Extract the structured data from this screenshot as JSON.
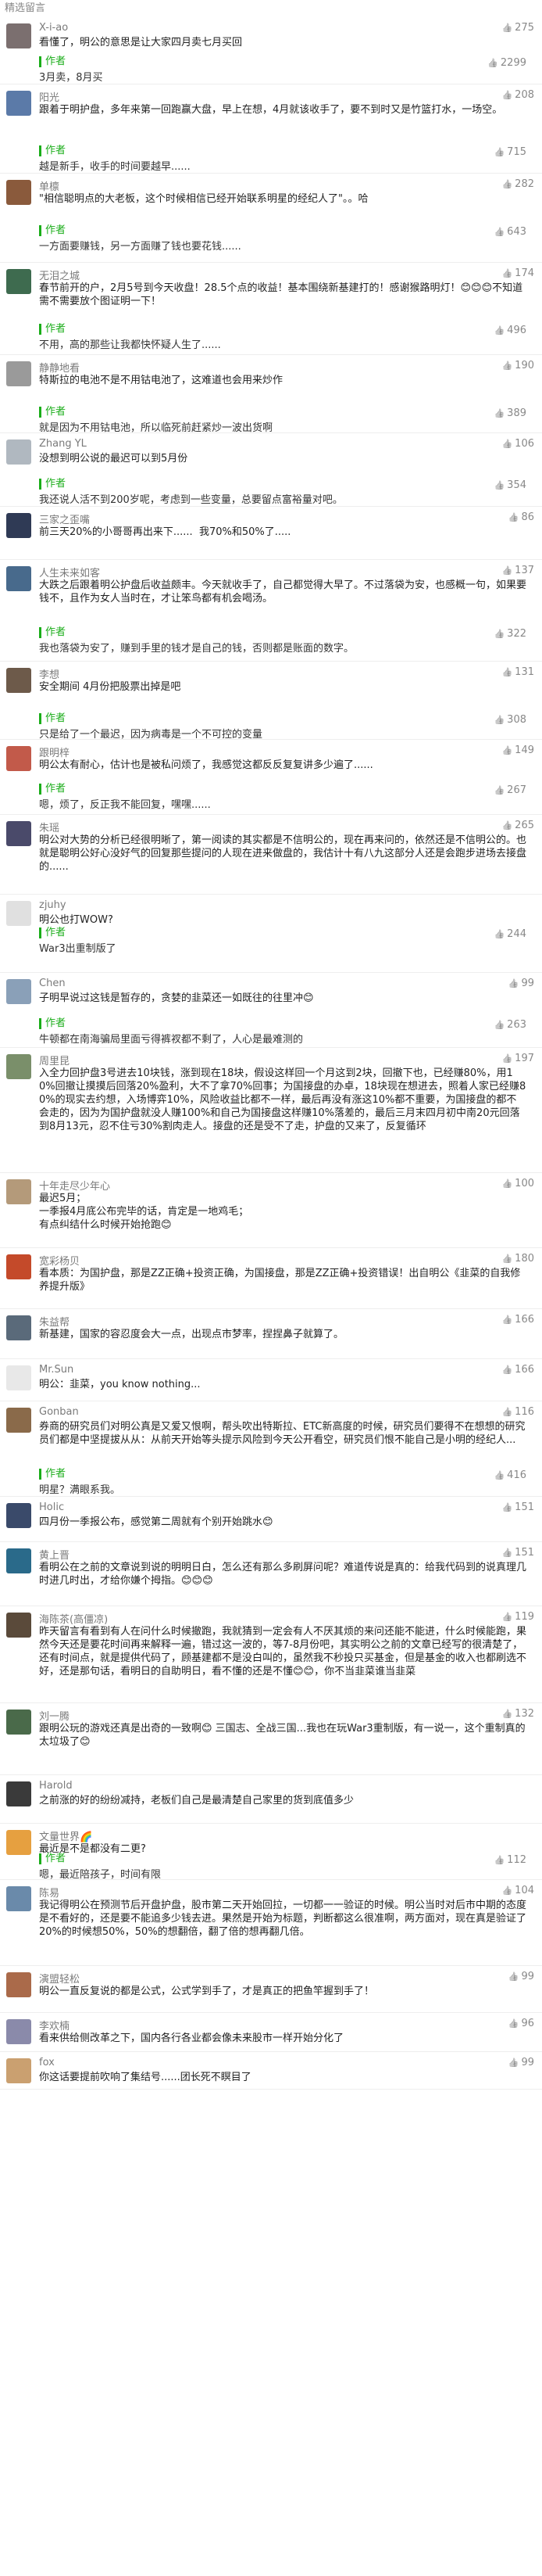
{
  "section_title": "精选留言",
  "author_label": "作者",
  "comments": [
    {
      "user": "X-i-ao",
      "likes": "275",
      "text": "看懂了，明公的意思是让大家四月卖七月买回",
      "reply_likes": "2299",
      "reply": "3月卖，8月买",
      "avatar_color": "#7b6f6f"
    },
    {
      "user": "阳光",
      "likes": "208",
      "text": "跟着于明护盘，多年来第一回跑赢大盘，早上在想，4月就该收手了，要不到时又是竹篮打水，一场空。",
      "reply_likes": "715",
      "reply": "越是新手，收手的时间要越早......",
      "avatar_color": "#5b7aa8"
    },
    {
      "user": "单檩",
      "likes": "282",
      "text": "\"相信聪明点的大老板，这个时候相信已经开始联系明星的经纪人了\"。。哈",
      "reply_likes": "643",
      "reply": "一方面要赚钱，另一方面赚了钱也要花钱......",
      "avatar_color": "#8a5a3c"
    },
    {
      "user": "无泪之城",
      "likes": "174",
      "text": "春节前开的户，2月5号到今天收盘！28.5个点的收益！基本围绕新基建打的！感谢猴路明灯！😊😊😊不知道需不需要放个图证明一下！",
      "reply_likes": "496",
      "reply": "不用，高的那些让我都快怀疑人生了......",
      "avatar_color": "#3e6b4f"
    },
    {
      "user": "静静地看",
      "likes": "190",
      "text": "特斯拉的电池不是不用钴电池了，这难道也会用来炒作",
      "reply_likes": "389",
      "reply": "就是因为不用钴电池，所以临死前赶紧炒一波出货啊",
      "avatar_color": "#9a9a9a"
    },
    {
      "user": "Zhang YL",
      "likes": "106",
      "text": "没想到明公说的最迟可以到5月份",
      "reply_likes": "354",
      "reply": "我还说人活不到200岁呢，考虑到一些变量，总要留点富裕量对吧。",
      "avatar_color": "#b0b8c0"
    },
    {
      "user": "三家之歪嘴",
      "likes": "86",
      "text": "前三天20%的小哥哥再出来下......  我70%和50%了.....",
      "reply_likes": "",
      "reply": "",
      "avatar_color": "#2f3a55"
    },
    {
      "user": "人生未来如客",
      "likes": "137",
      "text": "大跌之后跟着明公护盘后收益颇丰。今天就收手了，自己都觉得大早了。不过落袋为安，也感概一句，如果要钱不，且作为女人当时在，才让笨鸟都有机会喝汤。",
      "reply_likes": "322",
      "reply": "我也落袋为安了，赚到手里的钱才是自己的钱，否则都是账面的数字。",
      "avatar_color": "#486a8c"
    },
    {
      "user": "李想",
      "likes": "131",
      "text": "安全期间 4月份把股票出掉是吧",
      "reply_likes": "308",
      "reply": "只是给了一个最迟，因为病毒是一个不可控的变量",
      "avatar_color": "#6d5a4a"
    },
    {
      "user": "跟明梓",
      "likes": "149",
      "text": "明公太有耐心，估计也是被私问烦了，我感觉这都反反复复讲多少遍了......",
      "reply_likes": "267",
      "reply": "嗯，烦了，反正我不能回复，嘿嘿......",
      "avatar_color": "#c25a4a"
    },
    {
      "user": "朱瑶",
      "likes": "265",
      "text": "明公对大势的分析已经很明晰了，第一阅读的其实都是不信明公的，现在再来问的，依然还是不信明公的。也就是聪明公好心没好气的回复那些提问的人现在进来做盘的，我估计十有八九这部分人还是会跑步进场去接盘的......",
      "reply_likes": "",
      "reply": "",
      "avatar_color": "#4a4a6a"
    },
    {
      "user": "zjuhy",
      "likes": "",
      "text": "明公也打WOW?",
      "reply_likes": "244",
      "reply": "War3出重制版了",
      "avatar_color": "#e0e0e0"
    },
    {
      "user": "Chen",
      "likes": "99",
      "text": "子明早说过这钱是暂存的，贪婪的韭菜还一如既往的往里冲😊",
      "reply_likes": "263",
      "reply": "牛顿都在南海骗局里面亏得裤衩都不剩了，人心是最难测的",
      "avatar_color": "#8aa0b8"
    },
    {
      "user": "周里昆",
      "likes": "197",
      "text": "入全力回护盘3号进去10块钱，涨到现在18块，假设这样回一个月这到2块，回撤下也，已经赚80%，用10%回撤让摸摸后回落20%盈利，大不了拿70%回事；为国接盘的办卓，18块现在想进去，照着人家已经赚80%的现实去约想，入场博弈10%，风险收益比都不一样，最后再没有涨这10%都不重要，为国接盘的都不会走的，因为为国护盘就没人赚100%和自己为国接盘这样赚10%落差的，最后三月末四月初中南20元回落到8月13元，忍不住亏30%割肉走人。接盘的还是受不了走，护盘的又来了，反复循环",
      "reply_likes": "",
      "reply": "",
      "avatar_color": "#7a8f6a"
    },
    {
      "user": "十年走尽少年心",
      "likes": "100",
      "text": "最迟5月；\n一季报4月底公布完毕的话，肯定是一地鸡毛；\n有点纠结什么时候开始抢跑😊",
      "reply_likes": "",
      "reply": "",
      "avatar_color": "#b49a7a"
    },
    {
      "user": "宽彩杨贝",
      "likes": "180",
      "text": "看本质：为国护盘，那是ZZ正确+投资正确，为国接盘，那是ZZ正确+投资错误！出自明公《韭菜的自我修养提升版》",
      "reply_likes": "",
      "reply": "",
      "avatar_color": "#c44a2a"
    },
    {
      "user": "朱益帮",
      "likes": "166",
      "text": "新基建，国家的容忍度会大一点，出现点市梦率，捏捏鼻子就算了。",
      "reply_likes": "",
      "reply": "",
      "avatar_color": "#5a6a7a"
    },
    {
      "user": "Mr.Sun",
      "likes": "166",
      "text": "明公：韭菜，you know nothing...",
      "reply_likes": "",
      "reply": "",
      "avatar_color": "#e8e8e8"
    },
    {
      "user": "Gonban",
      "likes": "116",
      "text": "券商的研究员们对明公真是又爱又恨啊，帮头吹出特斯拉、ETC新高度的时候，研究员们要得不在想想的研究员们都是中坚提拔从从：从前天开始等头提示风险到今天公开看空，研究员们恨不能自己是小明的经纪人...",
      "reply_likes": "416",
      "reply": "明星？满眼系我。",
      "avatar_color": "#8a6a4a"
    },
    {
      "user": "Holic",
      "likes": "151",
      "text": "四月份一季报公布，感觉第二周就有个别开始跳水😊",
      "reply_likes": "",
      "reply": "",
      "avatar_color": "#3a4a6a"
    },
    {
      "user": "黄上晋",
      "likes": "151",
      "text": "看明公在之前的文章说到说的明明日白，怎么还有那么多刷屏问呢？难道传说是真的：给我代码到的说真理几时进几时出，才给你嫌个拇指。😊😊😊",
      "reply_likes": "",
      "reply": "",
      "avatar_color": "#2a6a8a"
    },
    {
      "user": "海陈茶(高僵凉)",
      "likes": "119",
      "text": "昨天留言有看到有人在问什么时候撤跑，我就猜到一定会有人不厌其烦的来问还能不能进，什么时候能跑，果然今天还是要花时间再来解释一遍，错过这一波的，等7-8月份吧，其实明公之前的文章已经写的很清楚了，还有时间点，就是提供代码了，顾基建都不是没白叫的，虽然我不秒投只买基金，但是基金的收入也都刷选不好，还是那句话，看明日的自助明日，看不懂的还是不懂😊😊，你不当韭菜谁当韭菜",
      "reply_likes": "",
      "reply": "",
      "avatar_color": "#5a4a3a"
    },
    {
      "user": "刘一腾",
      "likes": "132",
      "text": "跟明公玩的游戏还真是出奇的一致啊😊 三国志、全战三国...我也在玩War3重制版，有一说一，这个重制真的太垃圾了😊",
      "reply_likes": "",
      "reply": "",
      "avatar_color": "#4a6a4a"
    },
    {
      "user": "Harold",
      "likes": "",
      "text": "之前涨的好的纷纷减持，老板们自己是最清楚自己家里的货到底值多少",
      "reply_likes": "",
      "reply": "",
      "avatar_color": "#3a3a3a"
    },
    {
      "user": "文量世界🌈",
      "likes": "",
      "text": "最近是不是都没有二更?",
      "reply_likes": "112",
      "reply": "嗯，最近陪孩子，时间有限",
      "avatar_color": "#e6a040"
    },
    {
      "user": "陈易",
      "likes": "104",
      "text": "我记得明公在预测节后开盘护盘，股市第二天开始回拉，一切都一一验证的时候。明公当时对后市中期的态度是不看好的，还是要不能追多少钱去进。果然是开始为标题，判断都这么很准啊，两方面对，现在真是验证了20%的时候想50%，50%的想翻倍，翻了倍的想再翻几倍。",
      "reply_likes": "",
      "reply": "",
      "avatar_color": "#6a8aaa"
    },
    {
      "user": "演盟轻松",
      "likes": "99",
      "text": "明公一直反复说的都是公式，公式学到手了，才是真正的把鱼竿握到手了！",
      "reply_likes": "",
      "reply": "",
      "avatar_color": "#aa6a4a"
    },
    {
      "user": "李欢楠",
      "likes": "96",
      "text": "看来供给侧改革之下，国内各行各业都会像未来股市一样开始分化了",
      "reply_likes": "",
      "reply": "",
      "avatar_color": "#8a8aaa"
    },
    {
      "user": "fox",
      "likes": "99",
      "text": "你这话要提前吹响了集结号......团长死不瞑目了",
      "reply_likes": "",
      "reply": "",
      "avatar_color": "#caa070"
    }
  ]
}
